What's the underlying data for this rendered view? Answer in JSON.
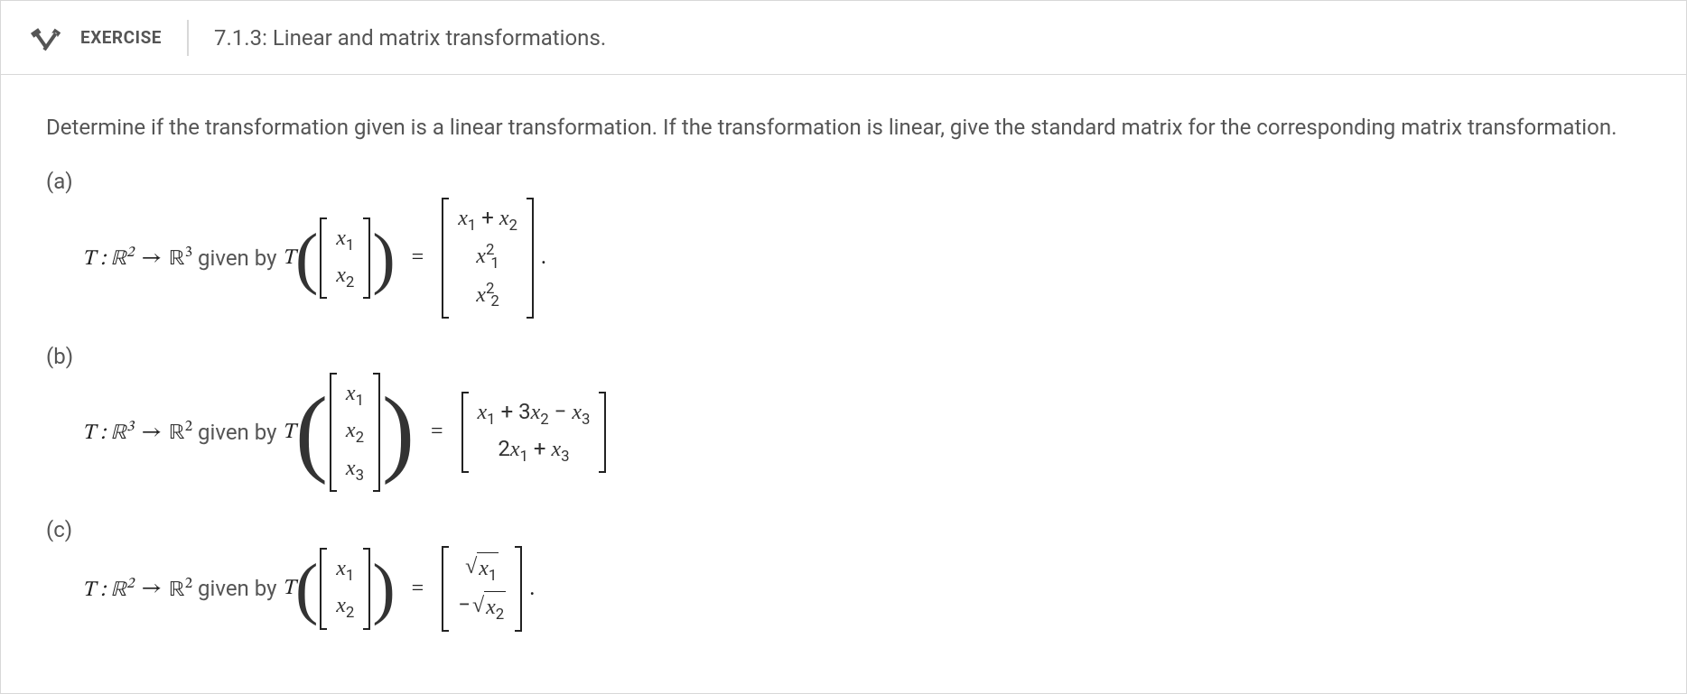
{
  "header": {
    "exercise_label": "EXERCISE",
    "title": "7.1.3: Linear and matrix transformations."
  },
  "prompt": "Determine if the transformation given is a linear transformation. If the transformation is linear, give the standard matrix for the corresponding matrix transformation.",
  "problems": {
    "a": {
      "label": "(a)",
      "map_prefix": "T : ℝ",
      "domain_exp": "2",
      "arrow": "→",
      "codomain_base": "ℝ",
      "codomain_exp": "3",
      "given_by": "given by",
      "T": "T",
      "input_rows": [
        "x₁",
        "x₂"
      ],
      "output_rows": [
        "x₁ + x₂",
        "x₁²",
        "x₂²"
      ]
    },
    "b": {
      "label": "(b)",
      "map_prefix": "T : ℝ",
      "domain_exp": "3",
      "arrow": "→",
      "codomain_base": "ℝ",
      "codomain_exp": "2",
      "given_by": "given by",
      "T": "T",
      "input_rows": [
        "x₁",
        "x₂",
        "x₃"
      ],
      "output_rows": [
        "x₁ + 3x₂ − x₃",
        "2x₁ + x₃"
      ]
    },
    "c": {
      "label": "(c)",
      "map_prefix": "T : ℝ",
      "domain_exp": "2",
      "arrow": "→",
      "codomain_base": "ℝ",
      "codomain_exp": "2",
      "given_by": "given by",
      "T": "T",
      "input_rows": [
        "x₁",
        "x₂"
      ],
      "output_rows": [
        "√x₁",
        "−√x₂"
      ]
    }
  }
}
